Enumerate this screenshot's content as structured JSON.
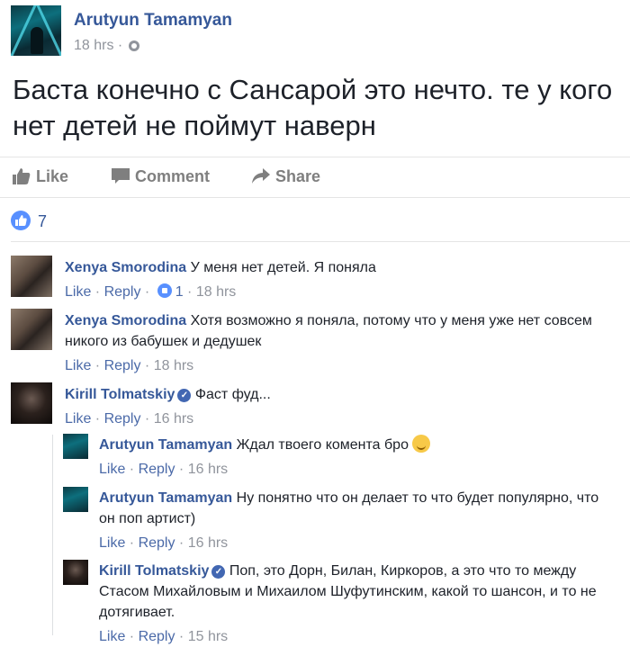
{
  "post": {
    "author": "Arutyun Tamamyan",
    "time": "18 hrs",
    "text": "Баста конечно с Сансарой это нечто. те у кого нет детей не поймут наверн"
  },
  "actions": {
    "like": "Like",
    "comment": "Comment",
    "share": "Share"
  },
  "reactions": {
    "count": "7"
  },
  "comments": [
    {
      "author": "Xenya Smorodina",
      "text": "У меня нет детей. Я поняла",
      "like": "Like",
      "reply": "Reply",
      "likes": "1",
      "time": "18 hrs"
    },
    {
      "author": "Xenya Smorodina",
      "text": "Хотя возможно я поняла, потому что у меня уже нет совсем никого из бабушек и дедушек",
      "like": "Like",
      "reply": "Reply",
      "time": "18 hrs"
    },
    {
      "author": "Kirill Tolmatskiy",
      "text": "Фаст фуд...",
      "like": "Like",
      "reply": "Reply",
      "time": "16 hrs"
    }
  ],
  "replies": [
    {
      "author": "Arutyun Tamamyan",
      "text": "Ждал твоего комента бро",
      "like": "Like",
      "reply": "Reply",
      "time": "16 hrs"
    },
    {
      "author": "Arutyun Tamamyan",
      "text": "Ну понятно что он делает то что будет популярно, что он поп артист)",
      "like": "Like",
      "reply": "Reply",
      "time": "16 hrs"
    },
    {
      "author": "Kirill Tolmatskiy",
      "text": "Поп, это Дорн, Билан, Киркоров, а это что то между Стасом Михайловым и Михаилом Шуфутинским, какой то шансон, и то не дотягивает.",
      "like": "Like",
      "reply": "Reply",
      "time": "15 hrs"
    }
  ],
  "colors": {
    "link": "#365899",
    "muted": "#90949c",
    "like_blue": "#5890ff"
  }
}
